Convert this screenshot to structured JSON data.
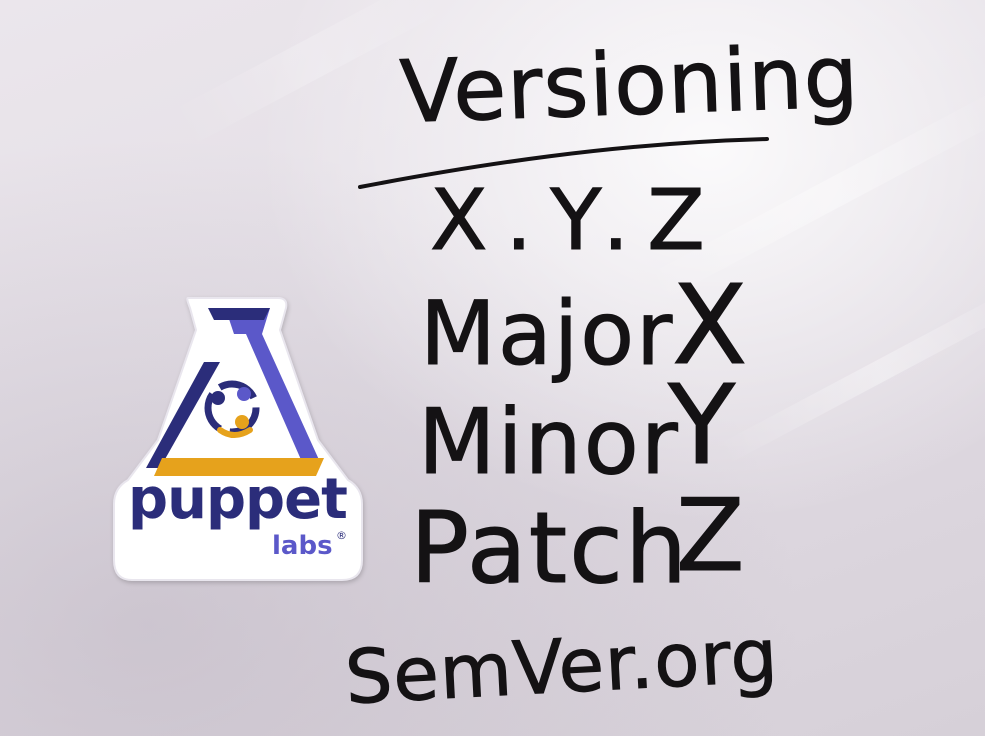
{
  "whiteboard": {
    "title": "Versioning",
    "format": "X.Y.Z",
    "rows": [
      {
        "label": "Major",
        "value": "X"
      },
      {
        "label": "Minor",
        "value": "Y"
      },
      {
        "label": "Patch",
        "value": "Z"
      }
    ],
    "footer": "SemVer.org",
    "ink_color": "#141214"
  },
  "sticker": {
    "brand": "puppet",
    "sub_brand": "labs",
    "registered_mark": "®",
    "colors": {
      "navy": "#2b2d7a",
      "purple": "#5b58c9",
      "orange": "#e6a21c",
      "white": "#ffffff"
    }
  }
}
